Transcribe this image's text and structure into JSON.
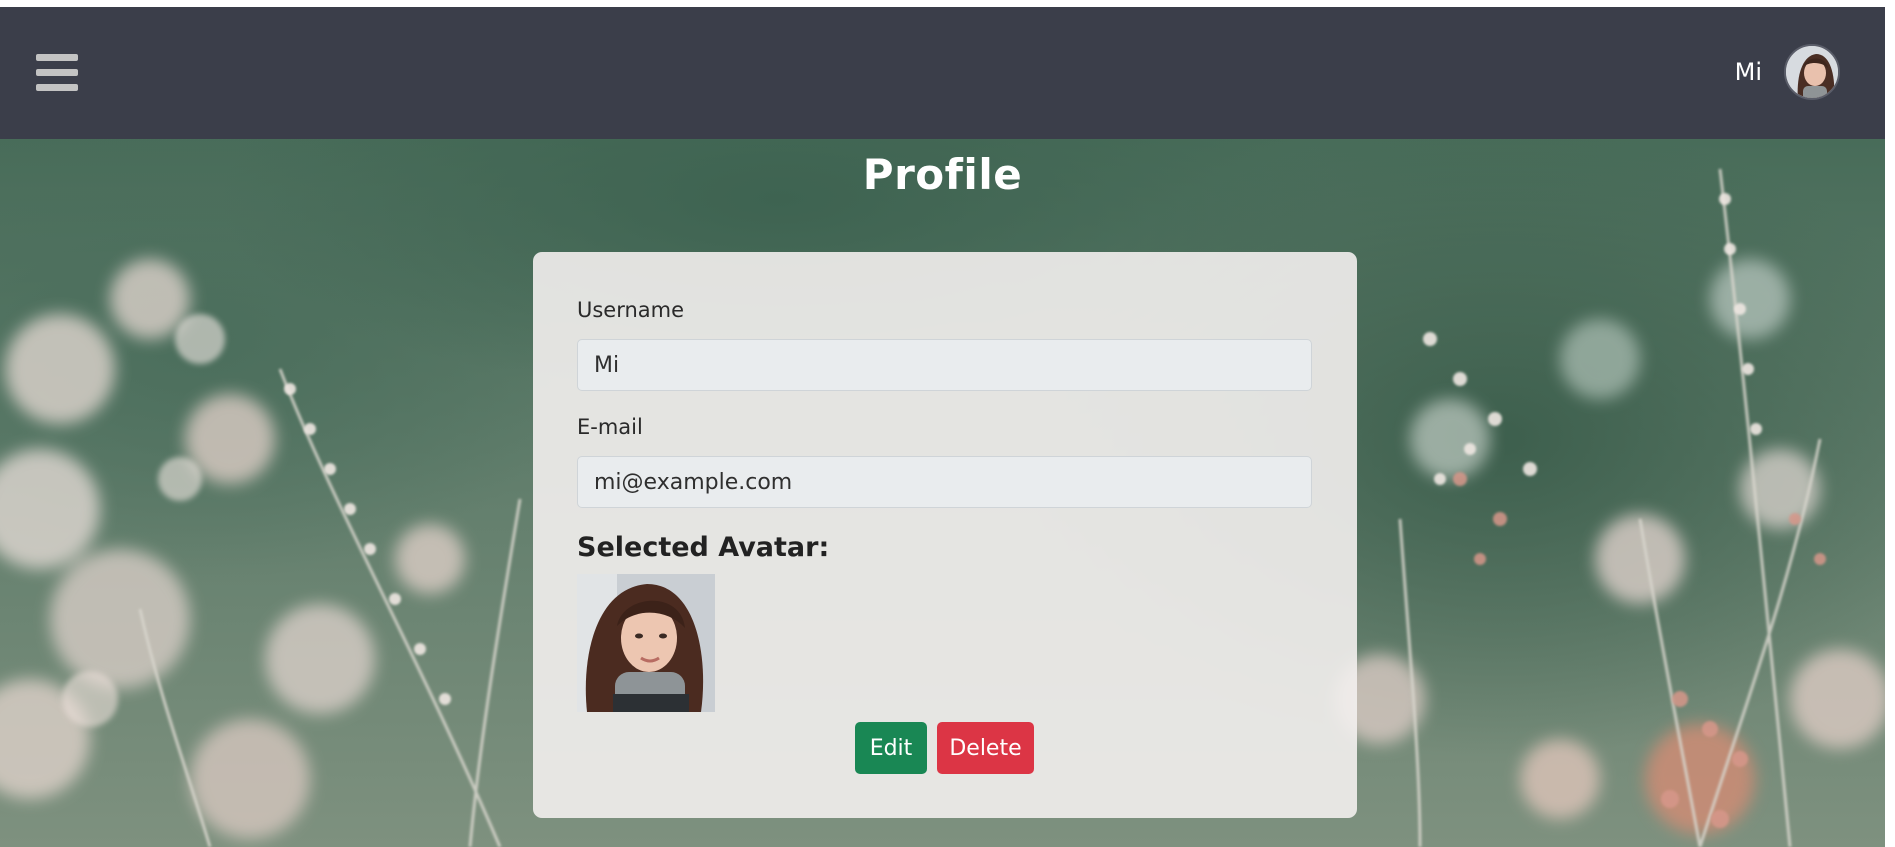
{
  "navbar": {
    "menu_icon": "hamburger-menu-icon",
    "username": "Mi",
    "avatar_icon": "user-avatar",
    "background_color": "#3b3e4a"
  },
  "page": {
    "title": "Profile"
  },
  "form": {
    "username_label": "Username",
    "username_value": "Mi",
    "email_label": "E-mail",
    "email_value": "mi@example.com",
    "avatar_heading": "Selected Avatar:"
  },
  "actions": {
    "edit_label": "Edit",
    "delete_label": "Delete",
    "edit_color": "#198754",
    "delete_color": "#dc3545"
  }
}
